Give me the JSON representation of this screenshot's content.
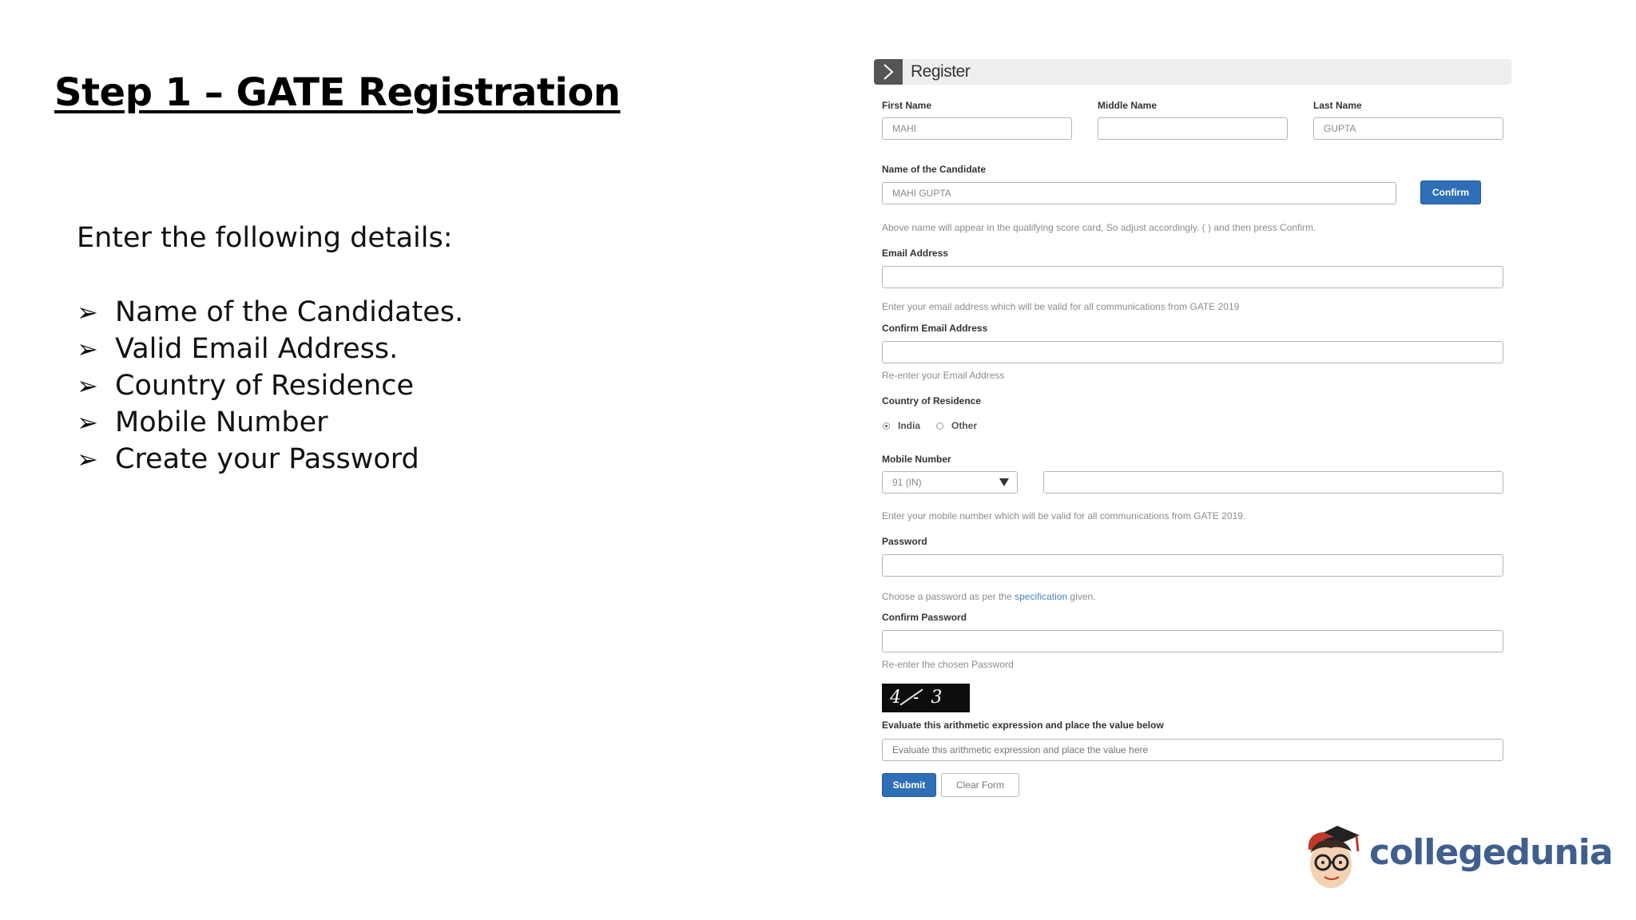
{
  "slide": {
    "title": "Step 1 – GATE Registration",
    "intro": "Enter the following details:",
    "bullet_glyph": "➢",
    "bullets": [
      "Name of the Candidates.",
      "Valid Email Address.",
      "Country of Residence",
      "Mobile Number",
      "Create your Password"
    ]
  },
  "form": {
    "header_title": "Register",
    "first_name_label": "First Name",
    "first_name_value": "MAHI",
    "middle_name_label": "Middle Name",
    "middle_name_value": "",
    "last_name_label": "Last Name",
    "last_name_value": "GUPTA",
    "candidate_name_label": "Name of the Candidate",
    "candidate_name_value": "MAHI GUPTA",
    "confirm_button": "Confirm",
    "candidate_name_help": "Above name will appear in the qualifying score card, So adjust accordingly. (   ) and then press Confirm.",
    "email_label": "Email Address",
    "email_help": "Enter your email address which will be valid for all communications from GATE 2019",
    "confirm_email_label": "Confirm Email Address",
    "confirm_email_help": "Re-enter your Email Address",
    "country_label": "Country of Residence",
    "country_options": [
      "India",
      "Other"
    ],
    "country_selected": "India",
    "mobile_label": "Mobile Number",
    "mobile_code_value": "91 (IN)",
    "mobile_help": "Enter your mobile number which will be valid for all communications from GATE 2019.",
    "password_label": "Password",
    "password_help_prefix": "Choose a password as per the ",
    "password_help_link": "specification",
    "password_help_suffix": " given.",
    "confirm_password_label": "Confirm Password",
    "confirm_password_help": "Re-enter the chosen Password",
    "captcha_text": "4 - 3 =",
    "captcha_label": "Evaluate this arithmetic expression and place the value below",
    "captcha_placeholder": "Evaluate this arithmetic expression and place the value here",
    "submit_button": "Submit",
    "clear_button": "Clear Form"
  },
  "logo": {
    "text": "collegedunia"
  },
  "colors": {
    "button_blue": "#2e6fb7",
    "logo_text": "#3f5f8f",
    "link": "#4a84c4"
  }
}
